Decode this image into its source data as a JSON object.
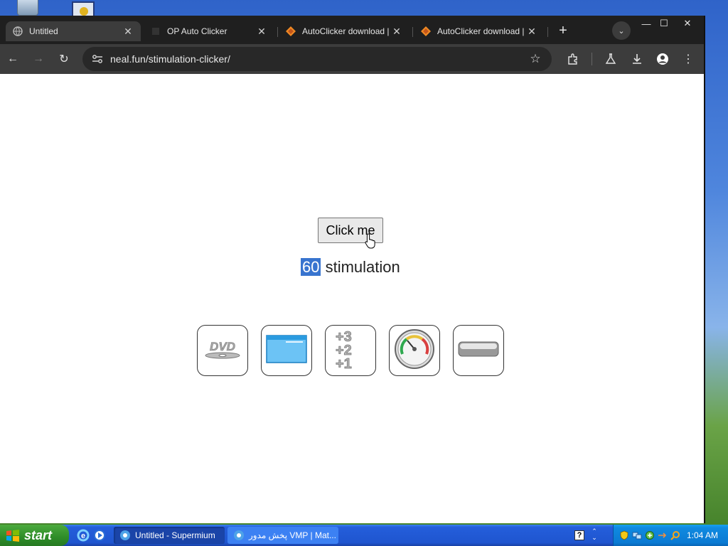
{
  "desktop": {
    "icons": [
      "recycle-bin-icon",
      "application-icon"
    ]
  },
  "browser": {
    "tabs": [
      {
        "title": "Untitled",
        "active": true
      },
      {
        "title": "OP Auto Clicker",
        "active": false
      },
      {
        "title": "AutoClicker download | S",
        "active": false
      },
      {
        "title": "AutoClicker download | S",
        "active": false
      }
    ],
    "new_tab_label": "+",
    "url": "neal.fun/stimulation-clicker/"
  },
  "page": {
    "button_label": "Click me",
    "counter_value": "60",
    "counter_unit": "stimulation",
    "upgrades": [
      "dvd-logo-icon",
      "blue-screen-icon",
      "plus-counter-icon",
      "speedometer-icon",
      "pill-button-icon"
    ]
  },
  "taskbar": {
    "start_label": "start",
    "tasks": [
      {
        "label": "Untitled - Supermium",
        "active": true
      },
      {
        "label": "پخش مدور VMP | Mat...",
        "active": false
      }
    ],
    "clock": "1:04 AM"
  },
  "colors": {
    "accent": "#3874cf",
    "taskbar": "#245edb",
    "start": "#2e8c28"
  }
}
